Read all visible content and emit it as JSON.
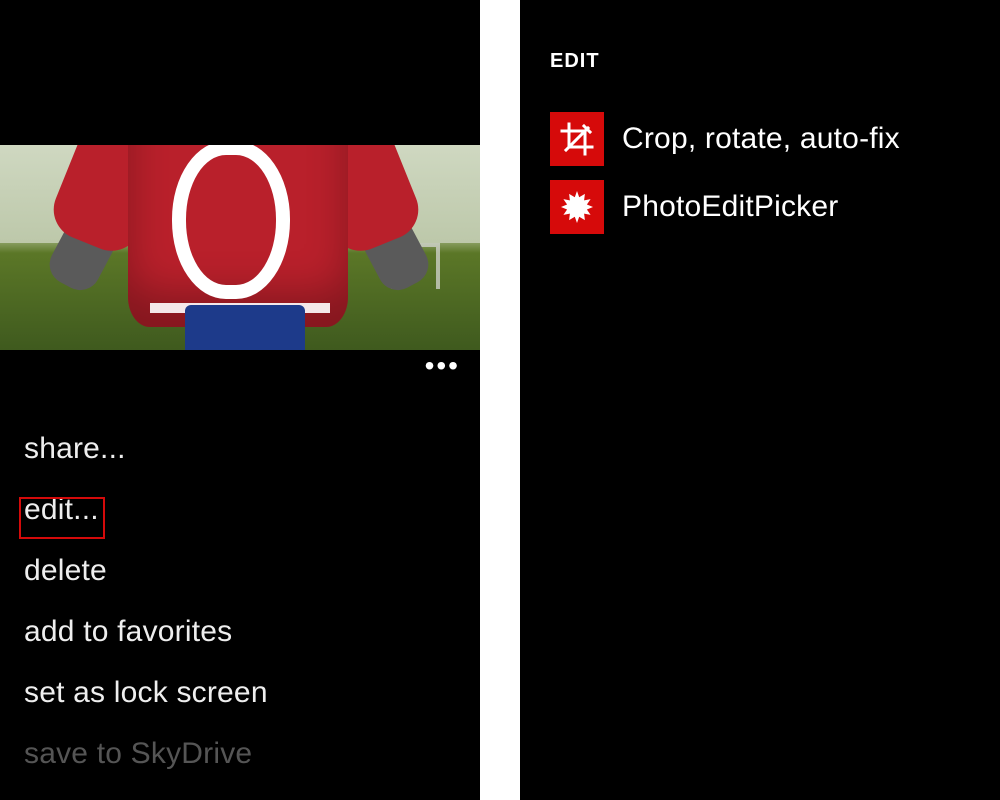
{
  "left": {
    "appbar_ellipsis": "•••",
    "menu": [
      {
        "label": "share..."
      },
      {
        "label": "edit..."
      },
      {
        "label": "delete"
      },
      {
        "label": "add to favorites"
      },
      {
        "label": "set as lock screen"
      },
      {
        "label": "save to SkyDrive"
      }
    ],
    "highlighted_index": 1
  },
  "right": {
    "header": "EDIT",
    "items": [
      {
        "icon": "crop-icon",
        "label": "Crop, rotate, auto-fix"
      },
      {
        "icon": "burst-icon",
        "label": "PhotoEditPicker"
      }
    ]
  },
  "colors": {
    "accent": "#d60a0a"
  }
}
